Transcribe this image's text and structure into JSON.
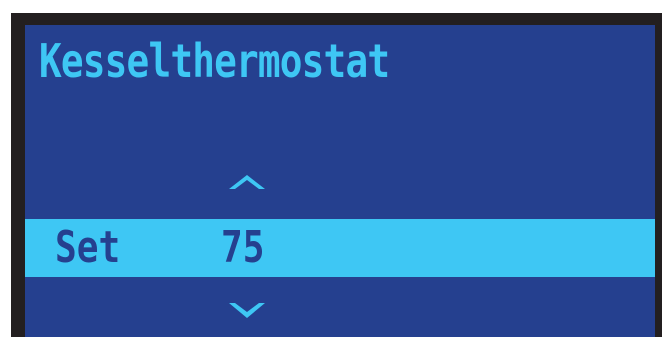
{
  "screen": {
    "title": "Kesselthermostat",
    "setting": {
      "label": "Set",
      "value": "75"
    },
    "icons": {
      "up": "chevron-up-icon",
      "down": "chevron-down-icon"
    }
  },
  "colors": {
    "bezel": "#231f20",
    "background": "#25408f",
    "accent": "#3ec7f4"
  }
}
